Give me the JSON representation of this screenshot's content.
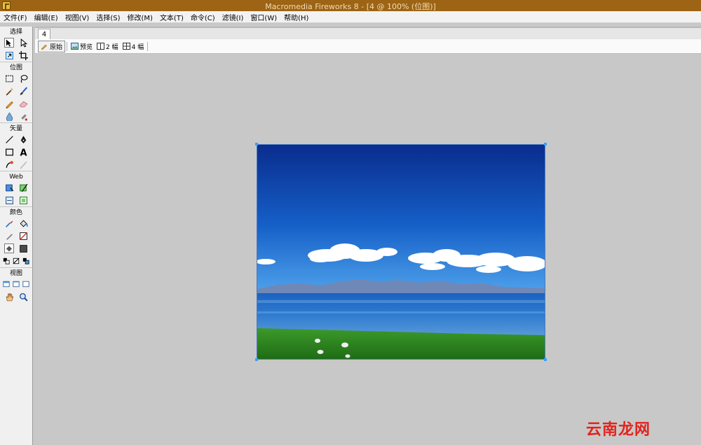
{
  "window": {
    "title": "Macromedia Fireworks 8 - [4 @ 100% (位图)]"
  },
  "menu": [
    "文件(F)",
    "编辑(E)",
    "视图(V)",
    "选择(S)",
    "修改(M)",
    "文本(T)",
    "命令(C)",
    "滤镜(I)",
    "窗口(W)",
    "帮助(H)"
  ],
  "tools": {
    "sections": {
      "select": "选择",
      "bitmap": "位图",
      "vector": "矢量",
      "web": "Web",
      "colors": "颜色",
      "view": "视图"
    },
    "text_tool_glyph": "A"
  },
  "document": {
    "tab": "4",
    "view_modes": {
      "original": "原始",
      "preview": "预览",
      "two_up": "2 幅",
      "four_up": "4 幅"
    }
  },
  "watermark": "云南龙网",
  "colors": {
    "titlebar": "#9c6414",
    "handle": "#39a0ff",
    "watermark": "#e3231d"
  }
}
